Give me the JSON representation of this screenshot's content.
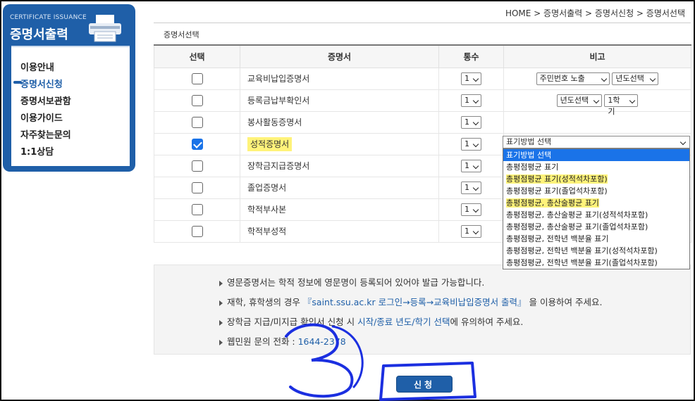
{
  "sidebar": {
    "en_title": "CERTIFICATE ISSUANCE",
    "ko_title": "증명서출력",
    "items": [
      {
        "label": "이용안내"
      },
      {
        "label": "증명서신청"
      },
      {
        "label": "증명서보관함"
      },
      {
        "label": "이용가이드"
      },
      {
        "label": "자주찾는문의"
      },
      {
        "label": "1:1상담"
      }
    ]
  },
  "breadcrumb": "HOME > 증명서출력 > 증명서신청 > 증명서선택",
  "panel": {
    "title": "증명서선택",
    "headers": {
      "select": "선택",
      "cert": "증명서",
      "count": "통수",
      "note": "비고"
    },
    "rows": [
      {
        "name": "교육비납입증명서",
        "count": "1",
        "checked": false,
        "note_selects": [
          "주민번호 노출",
          "년도선택"
        ]
      },
      {
        "name": "등록금납부확인서",
        "count": "1",
        "checked": false,
        "note_selects": [
          "년도선택",
          "1학기"
        ]
      },
      {
        "name": "봉사활동증명서",
        "count": "1",
        "checked": false,
        "note_selects": []
      },
      {
        "name": "성적증명서",
        "count": "1",
        "checked": true,
        "note_selects": []
      },
      {
        "name": "장학금지급증명서",
        "count": "1",
        "checked": false,
        "note_selects": []
      },
      {
        "name": "졸업증명서",
        "count": "1",
        "checked": false,
        "note_selects": []
      },
      {
        "name": "학적부사본",
        "count": "1",
        "checked": false,
        "note_selects": []
      },
      {
        "name": "학적부성적",
        "count": "1",
        "checked": false,
        "note_selects": []
      }
    ]
  },
  "dropdown": {
    "current": "표기방법 선택",
    "options": [
      "표기방법 선택",
      "총평점평균 표기",
      "총평점평균 표기(성적석차포함)",
      "총평점평균 표기(졸업석차포함)",
      "총평점평균, 총산술평균 표기",
      "총평점평균, 총산술평균 표기(성적석차포함)",
      "총평점평균, 총산술평균 표기(졸업석차포함)",
      "총평점평균, 전학년 백분율 표기",
      "총평점평균, 전학년 백분율 표기(성적석차포함)",
      "총평점평균, 전학년 백분율 표기(졸업석차포함)"
    ]
  },
  "notes": {
    "n1": "영문증명서는 학적 정보에 영문명이 등록되어 있어야 발급 가능합니다.",
    "n2_a": "재학, 휴학생의 경우 ",
    "n2_b": "『saint.ssu.ac.kr 로그인→등록→교육비납입증명서 출력』",
    "n2_c": " 을 이용하여 주세요.",
    "n3_a": "장학금 지급/미지급 확인서 신청 시 ",
    "n3_b": "시작/종료 년도/학기 선택",
    "n3_c": "에 유의하여 주세요.",
    "n4_a": "웹민원 문의 전화 : ",
    "n4_b": "1644-2378"
  },
  "submit_label": "신청",
  "colors": {
    "brand": "#1f5fa8",
    "highlight": "#fff37a",
    "annotation": "#1b2fe0",
    "checkbox": "#1a73e8"
  }
}
